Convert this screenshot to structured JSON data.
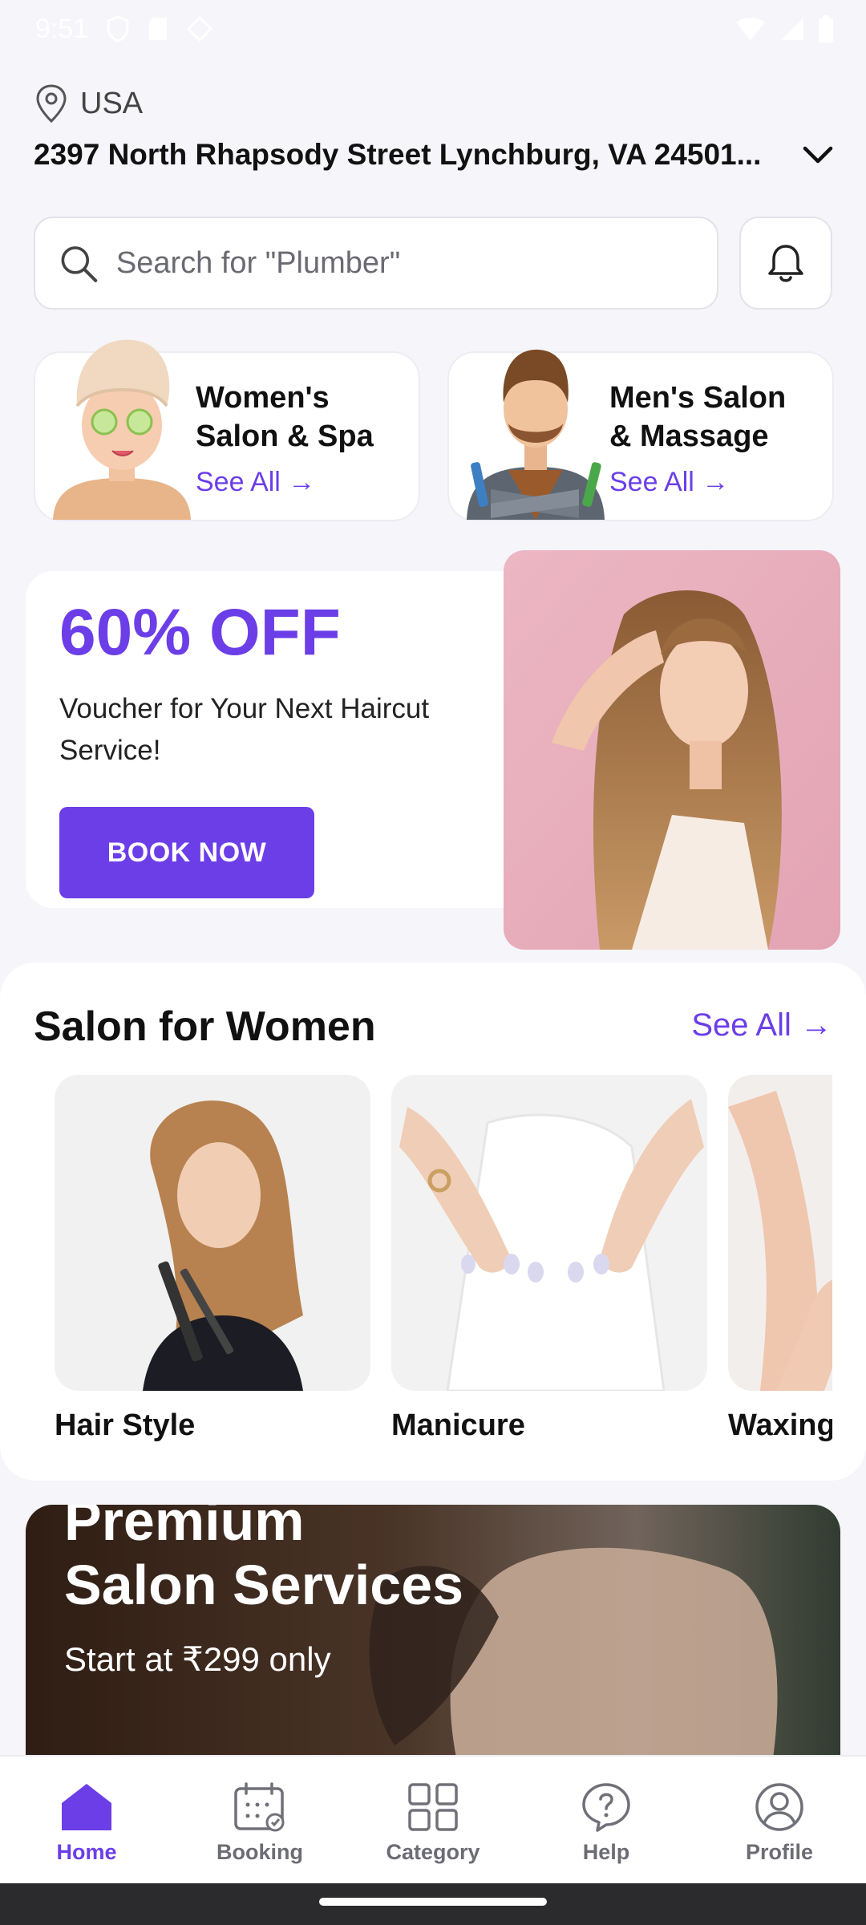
{
  "status_bar": {
    "time": "9:51"
  },
  "location": {
    "country": "USA",
    "address": "2397 North Rhapsody Street Lynchburg, VA 24501..."
  },
  "search": {
    "placeholder": "Search for \"Plumber\""
  },
  "categories": [
    {
      "title_line1": "Women's",
      "title_line2": "Salon & Spa",
      "see_all": "See All →"
    },
    {
      "title_line1": "Men's Salon",
      "title_line2": "& Massage",
      "see_all": "See All →"
    }
  ],
  "promo": {
    "headline": "60% OFF",
    "subtitle": "Voucher for Your Next Haircut Service!",
    "cta": "BOOK NOW"
  },
  "salon_section": {
    "title": "Salon for Women",
    "see_all": "See All →",
    "services": [
      {
        "label": "Hair Style"
      },
      {
        "label": "Manicure"
      },
      {
        "label": "Waxing"
      }
    ]
  },
  "banner": {
    "line1": "Premium",
    "line2": "Salon Services",
    "subtitle": "Start at ₹299 only"
  },
  "bottom_nav": [
    {
      "label": "Home",
      "active": true
    },
    {
      "label": "Booking",
      "active": false
    },
    {
      "label": "Category",
      "active": false
    },
    {
      "label": "Help",
      "active": false
    },
    {
      "label": "Profile",
      "active": false
    }
  ],
  "colors": {
    "accent": "#6b3ee8",
    "background": "#f5f5fa",
    "card": "#ffffff"
  }
}
